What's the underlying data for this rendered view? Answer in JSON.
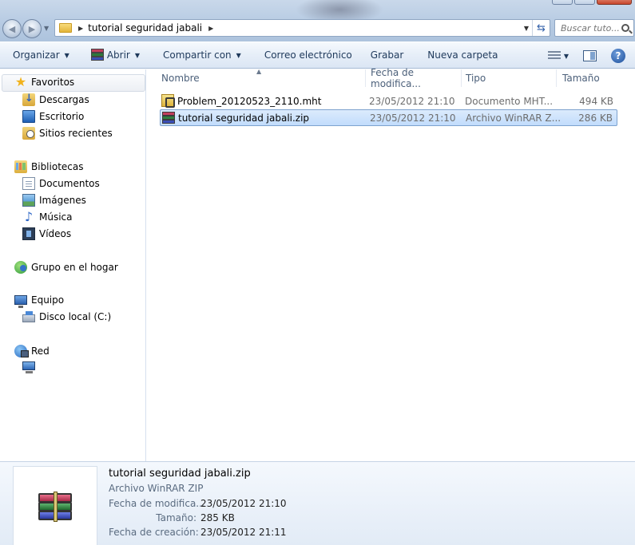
{
  "address": {
    "crumb": "tutorial seguridad jabali"
  },
  "search": {
    "placeholder": "Buscar tuto..."
  },
  "toolbar": {
    "organizar": "Organizar",
    "abrir": "Abrir",
    "compartir": "Compartir con",
    "correo": "Correo electrónico",
    "grabar": "Grabar",
    "nueva_carpeta": "Nueva carpeta",
    "help": "?"
  },
  "sidebar": {
    "favoritos": "Favoritos",
    "descargas": "Descargas",
    "escritorio": "Escritorio",
    "sitios_recientes": "Sitios recientes",
    "bibliotecas": "Bibliotecas",
    "documentos": "Documentos",
    "imagenes": "Imágenes",
    "musica": "Música",
    "videos": "Vídeos",
    "grupo_hogar": "Grupo en el hogar",
    "equipo": "Equipo",
    "disco_local": "Disco local (C:)",
    "red": "Red"
  },
  "columns": {
    "nombre": "Nombre",
    "fecha": "Fecha de modifica...",
    "tipo": "Tipo",
    "tamano": "Tamaño"
  },
  "files": [
    {
      "name": "Problem_20120523_2110.mht",
      "date": "23/05/2012 21:10",
      "type": "Documento MHT...",
      "size": "494 KB",
      "icon": "mht-file-icon",
      "selected": false
    },
    {
      "name": "tutorial seguridad jabali.zip",
      "date": "23/05/2012 21:10",
      "type": "Archivo WinRAR Z...",
      "size": "286 KB",
      "icon": "winrar-zip-icon",
      "selected": true
    }
  ],
  "details": {
    "title": "tutorial seguridad jabali.zip",
    "type": "Archivo WinRAR ZIP",
    "fecha_mod_label": "Fecha de modifica...",
    "fecha_mod_value": "23/05/2012 21:10",
    "tamano_label": "Tamaño:",
    "tamano_value": "285 KB",
    "fecha_creacion_label": "Fecha de creación:",
    "fecha_creacion_value": "23/05/2012 21:11"
  },
  "colors": {
    "accent": "#1e395b",
    "selection": "#c1dcfc",
    "selection_border": "#7da2ce"
  }
}
